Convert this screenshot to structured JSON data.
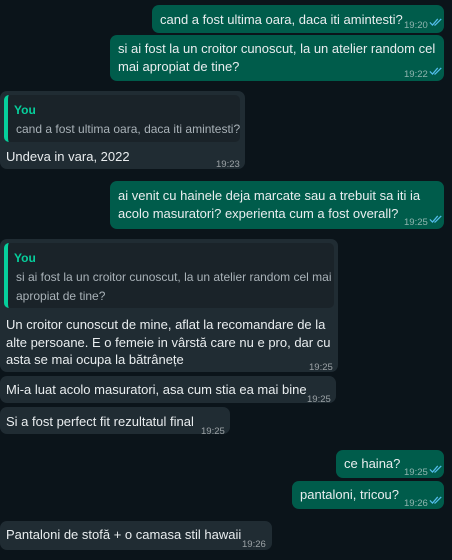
{
  "messages": {
    "m1": {
      "line1": "cand a fost ultima oara, daca iti amintesti?",
      "time": "19:20"
    },
    "m2": {
      "line1": "si ai fost la un croitor cunoscut, la un atelier random cel",
      "line2": "mai apropiat de tine?",
      "time": "19:22"
    },
    "m3": {
      "quote_author": "You",
      "quote_line1": "cand a fost ultima oara, daca iti amintesti?",
      "line1": "Undeva in vara, 2022",
      "time": "19:23"
    },
    "m4": {
      "line1": "ai venit cu hainele deja marcate sau a trebuit sa iti ia",
      "line2": "acolo masuratori? experienta cum a fost overall?",
      "time": "19:25"
    },
    "m5": {
      "quote_author": "You",
      "quote_line1": "si ai fost la un croitor cunoscut, la un atelier random cel mai",
      "quote_line2": "apropiat de tine?",
      "line1": "Un croitor cunoscut de mine, aflat la recomandare de la",
      "line2": "alte persoane. E o femeie in vârstă care nu e pro, dar cu",
      "line3": "asta se mai ocupa la bătrânețe",
      "time": "19:25"
    },
    "m6": {
      "line1": "Mi-a luat acolo masuratori, asa cum stia ea mai bine",
      "time": "19:25"
    },
    "m7": {
      "line1": "Si a fost perfect fit rezultatul final",
      "time": "19:25"
    },
    "m8": {
      "line1": "ce haina?",
      "time": "19:25"
    },
    "m9": {
      "line1": "pantaloni, tricou?",
      "time": "19:26"
    },
    "m10": {
      "line1": "Pantaloni de stofă + o camasa stil hawaii",
      "time": "19:26"
    }
  },
  "colors": {
    "background": "#0b141a",
    "outgoing_bubble": "#005c4b",
    "incoming_bubble": "#202c33",
    "quote_accent": "#06cf9c",
    "read_ticks": "#53bdeb"
  },
  "icons": {
    "read_receipt": "double-check-icon"
  }
}
